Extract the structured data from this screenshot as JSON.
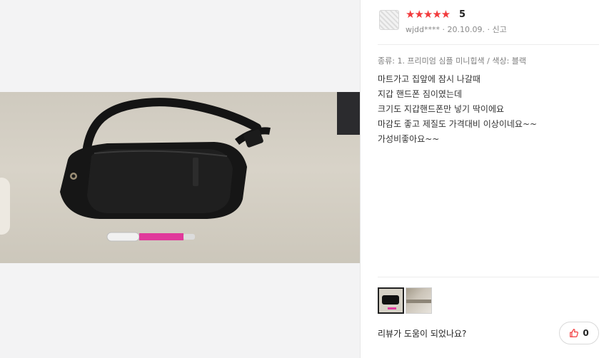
{
  "review": {
    "stars": "★★★★★",
    "score": "5",
    "author": "wjdd****",
    "date": "20.10.09.",
    "dot": "·",
    "report_label": "신고",
    "options": "종류: 1. 프리미엄 심플 미니힙색 / 색상: 블랙",
    "lines": [
      "마트가고 집앞에 잠시 나갈때",
      "지갑 핸드폰 짐이였는데",
      "크기도 지갑핸드폰만 넣기 딱이에요",
      "마감도 좋고 제질도 가격대비 이상이네요~~",
      "가성비좋아요~~"
    ],
    "rating_color": "#f23a3c"
  },
  "thumbnails": [
    {
      "name": "bag photo",
      "selected": true
    },
    {
      "name": "second photo",
      "selected": false
    }
  ],
  "feedback": {
    "question": "리뷰가 도움이 되었나요?",
    "like_count": "0",
    "like_icon": "thumbs-up-icon"
  }
}
